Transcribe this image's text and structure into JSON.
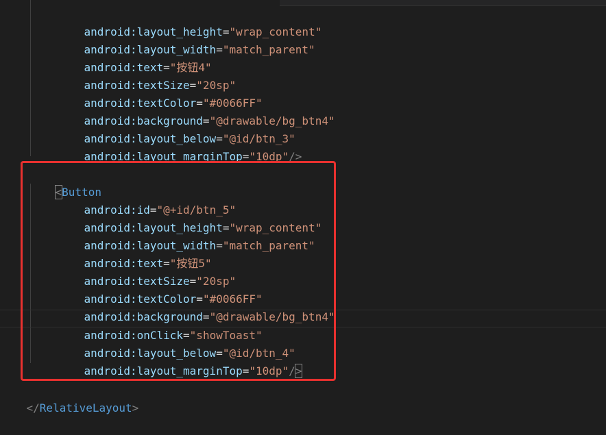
{
  "colors": {
    "background": "#1e1e1e",
    "attribute": "#9cdcfe",
    "value": "#ce9178",
    "tag": "#569cd6",
    "punctuation": "#808080",
    "highlight_box": "#e8312f"
  },
  "lines": [
    {
      "attr": "android:layout_height",
      "val": "\"wrap_content\""
    },
    {
      "attr": "android:layout_width",
      "val": "\"match_parent\""
    },
    {
      "attr": "android:text",
      "val": "\"按钮4\""
    },
    {
      "attr": "android:textSize",
      "val": "\"20sp\""
    },
    {
      "attr": "android:textColor",
      "val": "\"#0066FF\""
    },
    {
      "attr": "android:background",
      "val": "\"@drawable/bg_btn4\""
    },
    {
      "attr": "android:layout_below",
      "val": "\"@id/btn_3\""
    },
    {
      "attr": "android:layout_marginTop",
      "val": "\"10dp\"",
      "close": "/>"
    },
    {
      "tag_open": "<",
      "tag": "Button"
    },
    {
      "attr": "android:id",
      "val": "\"@+id/btn_5\""
    },
    {
      "attr": "android:layout_height",
      "val": "\"wrap_content\""
    },
    {
      "attr": "android:layout_width",
      "val": "\"match_parent\""
    },
    {
      "attr": "android:text",
      "val": "\"按钮5\""
    },
    {
      "attr": "android:textSize",
      "val": "\"20sp\""
    },
    {
      "attr": "android:textColor",
      "val": "\"#0066FF\""
    },
    {
      "attr": "android:background",
      "val": "\"@drawable/bg_btn4\""
    },
    {
      "attr": "android:onClick",
      "val": "\"showToast\""
    },
    {
      "attr": "android:layout_below",
      "val": "\"@id/btn_4\""
    },
    {
      "attr": "android:layout_marginTop",
      "val": "\"10dp\"",
      "close_slash": "/",
      "close_gt": ">"
    },
    {
      "close_tag_open": "</",
      "close_tag": "RelativeLayout",
      "close_tag_end": ">"
    }
  ]
}
